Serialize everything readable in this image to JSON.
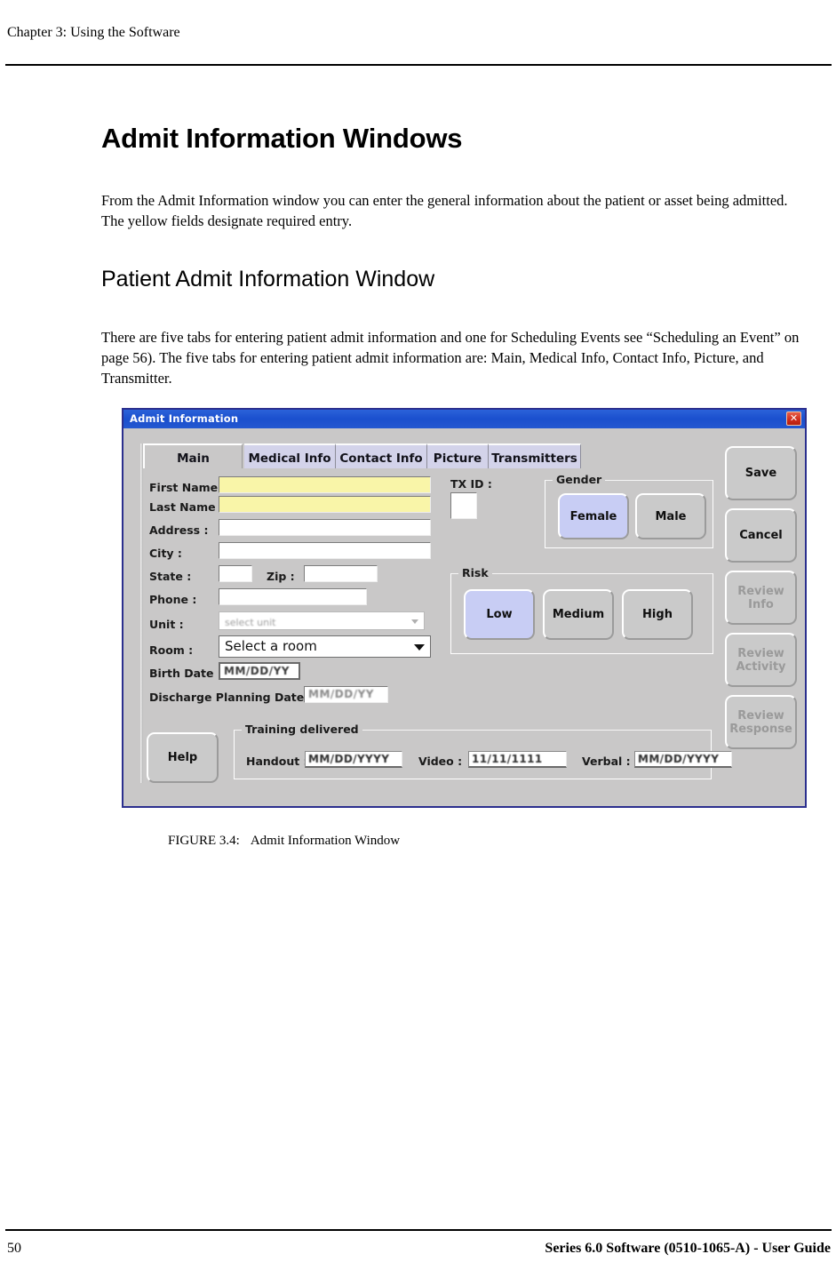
{
  "page": {
    "header_chapter": "Chapter 3: Using the Software",
    "page_number": "50",
    "guide_title": "Series 6.0 Software (0510-1065-A) - User Guide"
  },
  "content": {
    "h1": "Admit Information Windows",
    "para1": "From the Admit Information window you can enter the general information about the patient or asset being admitted. The yellow fields designate required entry.",
    "h2": "Patient Admit Information Window",
    "para2": "There are five tabs for entering patient admit information and one for Scheduling Events see “Scheduling an Event” on page 56). The five tabs for entering patient admit information are: Main, Medical Info, Contact Info, Picture, and Transmitter.",
    "figure_label": "FIGURE 3.4:",
    "figure_caption": "Admit Information Window"
  },
  "dialog": {
    "title": "Admit Information",
    "close_label": "✕",
    "tabs": [
      {
        "label": "Main",
        "active": true
      },
      {
        "label": "Medical Info",
        "active": false
      },
      {
        "label": "Contact Info",
        "active": false
      },
      {
        "label": "Picture",
        "active": false
      },
      {
        "label": "Transmitters",
        "active": false
      }
    ],
    "fields": {
      "first_name_label": "First Name :",
      "first_name_value": "",
      "last_name_label": "Last Name :",
      "last_name_value": "",
      "address_label": "Address :",
      "address_value": "",
      "city_label": "City :",
      "city_value": "",
      "state_label": "State :",
      "state_value": "",
      "zip_label": "Zip :",
      "zip_value": "",
      "phone_label": "Phone :",
      "phone_value": "",
      "unit_label": "Unit :",
      "unit_value": "select unit",
      "room_label": "Room :",
      "room_value": "Select a room",
      "birth_date_label": "Birth Date :",
      "birth_date_value": "MM/DD/YY",
      "discharge_label": "Discharge Planning Date :",
      "discharge_value": "MM/DD/YY",
      "tx_id_label": "TX ID :",
      "tx_id_value": ""
    },
    "gender": {
      "title": "Gender",
      "options": [
        {
          "label": "Female",
          "selected": true
        },
        {
          "label": "Male",
          "selected": false
        }
      ]
    },
    "risk": {
      "title": "Risk",
      "options": [
        {
          "label": "Low",
          "selected": true
        },
        {
          "label": "Medium",
          "selected": false
        },
        {
          "label": "High",
          "selected": false
        }
      ]
    },
    "training": {
      "title": "Training delivered",
      "handout_label": "Handout :",
      "handout_value": "MM/DD/YYYY",
      "video_label": "Video :",
      "video_value": "11/11/1111",
      "verbal_label": "Verbal :",
      "verbal_value": "MM/DD/YYYY"
    },
    "help_button": "Help",
    "action_buttons": [
      {
        "label": "Save",
        "enabled": true
      },
      {
        "label": "Cancel",
        "enabled": true
      },
      {
        "label": "Review Info",
        "enabled": false
      },
      {
        "label": "Review Activity",
        "enabled": false
      },
      {
        "label": "Review Response",
        "enabled": false
      }
    ],
    "colors": {
      "titlebar": "#1a4fce",
      "close_button": "#cf2b1b",
      "dialog_face": "#c9c8c8",
      "required_field": "#f9f5a8",
      "selected_button": "#c8cdf4",
      "tab_inactive": "#d3d3ea"
    }
  }
}
